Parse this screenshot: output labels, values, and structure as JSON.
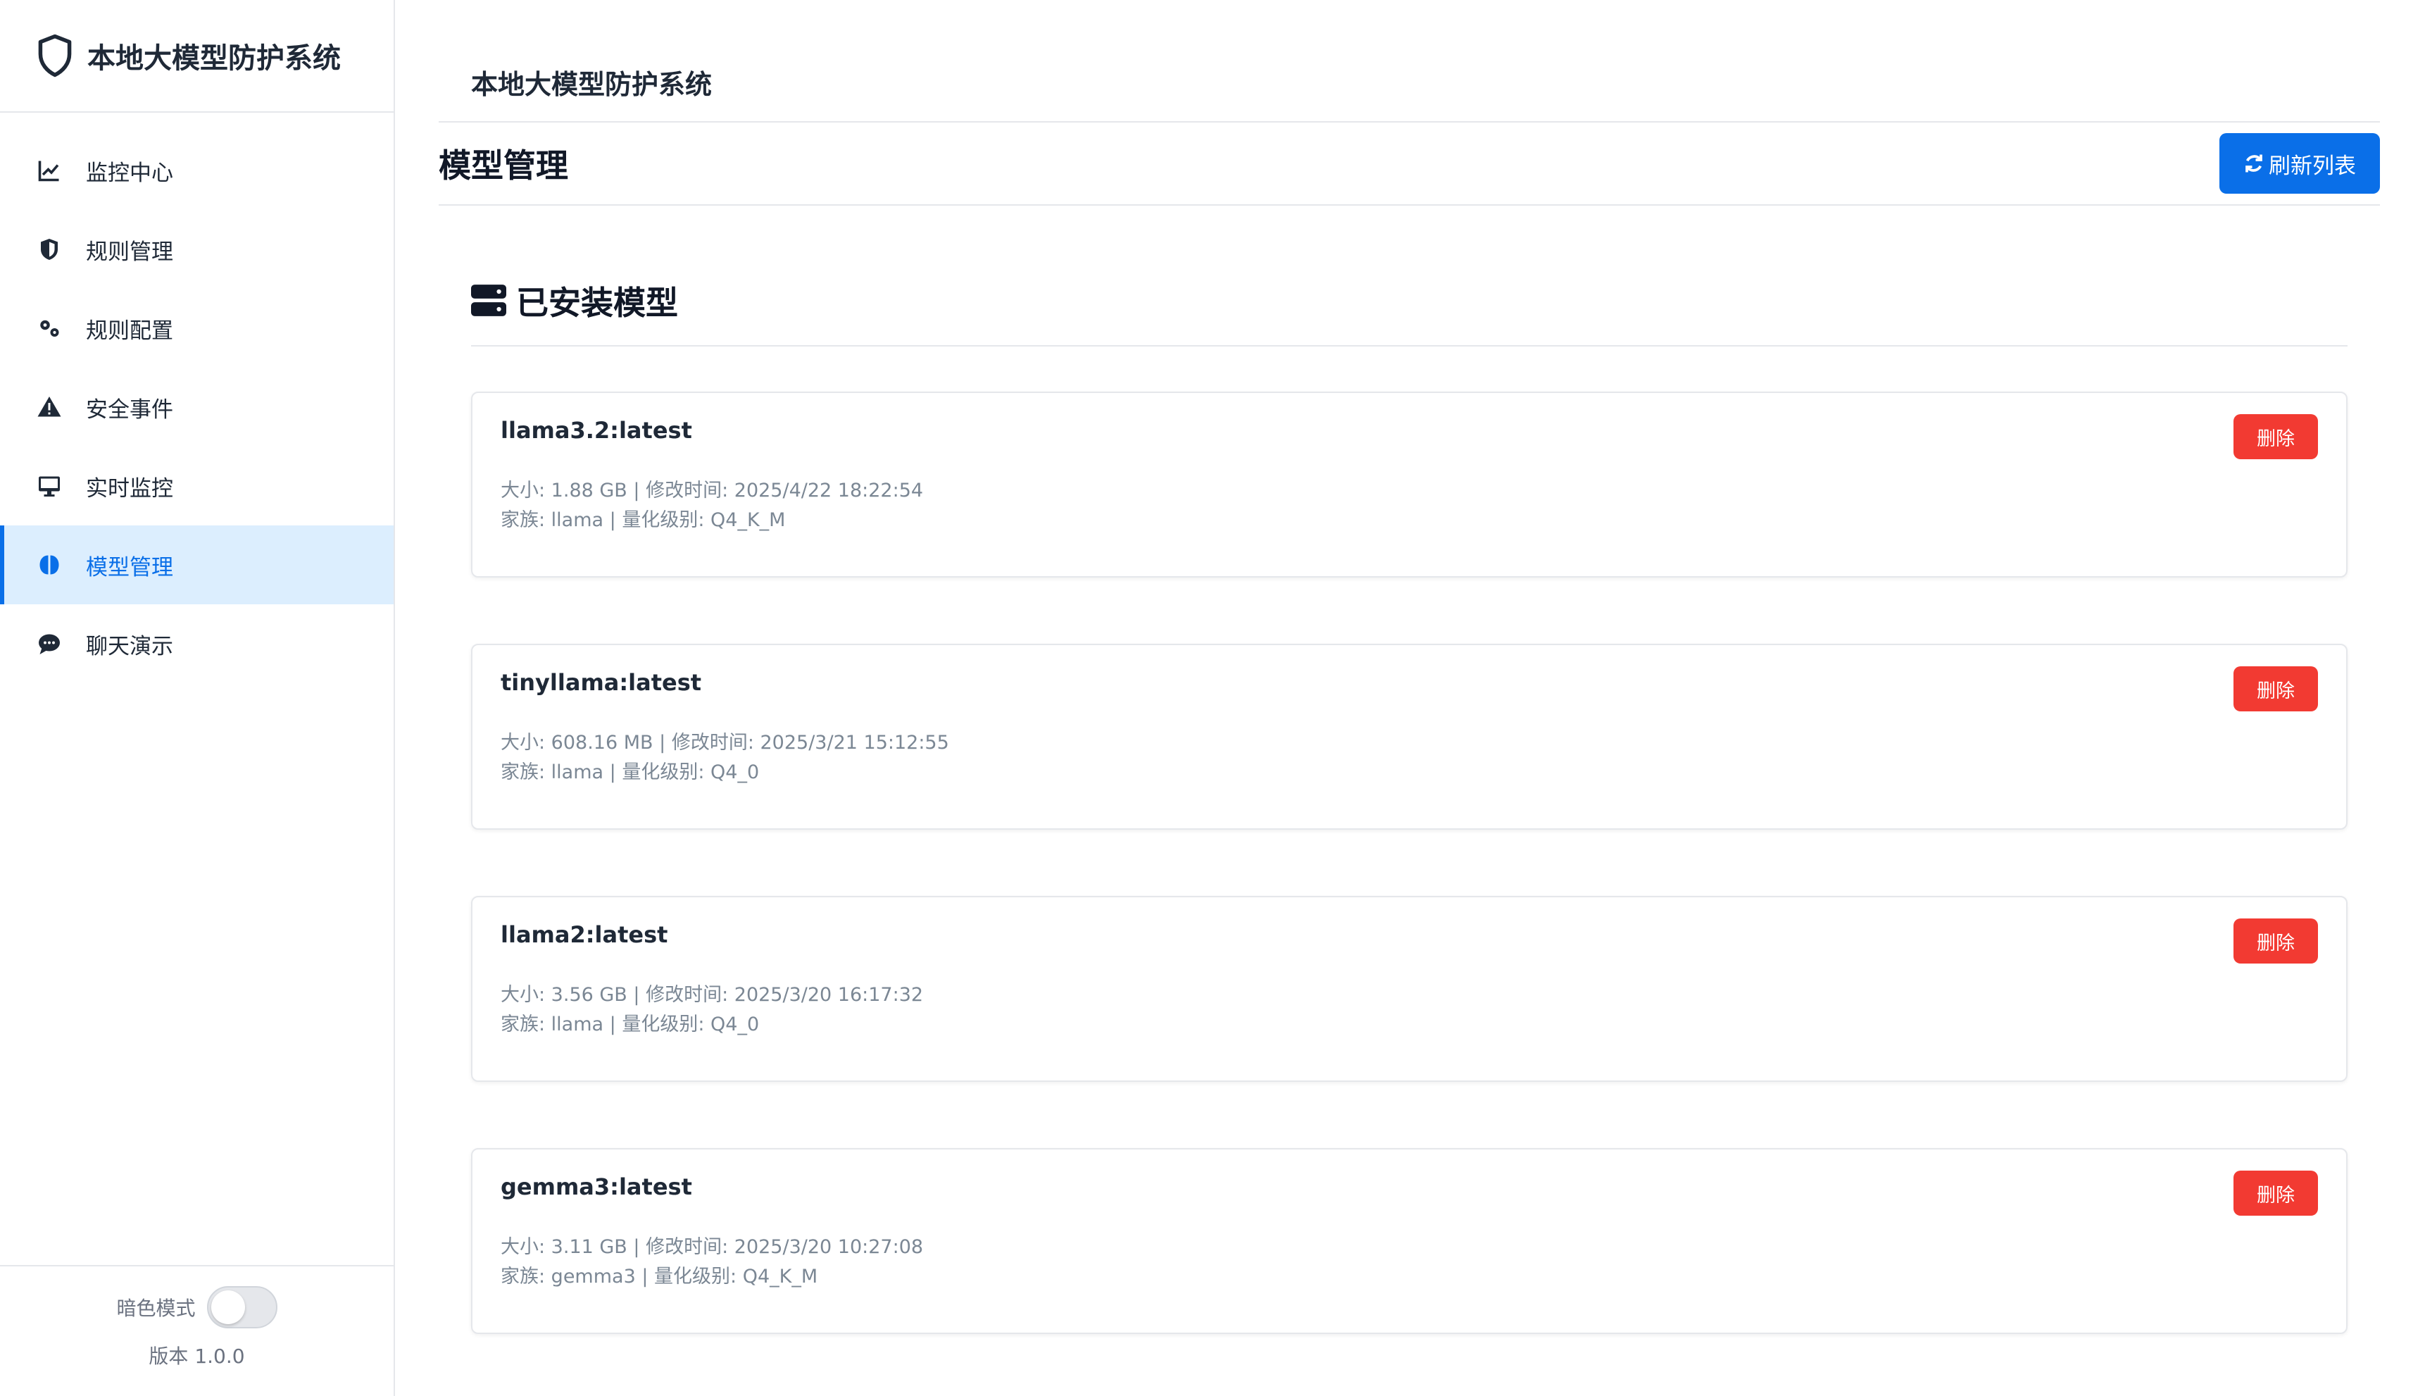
{
  "app": {
    "title": "本地大模型防护系统"
  },
  "sidebar": {
    "items": [
      {
        "label": "监控中心",
        "icon": "line-chart-icon"
      },
      {
        "label": "规则管理",
        "icon": "shield-icon"
      },
      {
        "label": "规则配置",
        "icon": "gears-icon"
      },
      {
        "label": "安全事件",
        "icon": "warning-icon"
      },
      {
        "label": "实时监控",
        "icon": "monitor-icon"
      },
      {
        "label": "模型管理",
        "icon": "brain-icon",
        "active": true
      },
      {
        "label": "聊天演示",
        "icon": "chat-icon"
      }
    ],
    "dark_mode_label": "暗色模式",
    "dark_mode_on": false,
    "version": "版本 1.0.0"
  },
  "header": {
    "title": "本地大模型防护系统"
  },
  "page": {
    "title": "模型管理",
    "refresh_label": "刷新列表"
  },
  "panel": {
    "title": "已安装模型"
  },
  "models": [
    {
      "name": "llama3.2:latest",
      "line1": "大小: 1.88 GB | 修改时间: 2025/4/22 18:22:54",
      "line2": "家族: llama | 量化级别: Q4_K_M",
      "delete_label": "删除"
    },
    {
      "name": "tinyllama:latest",
      "line1": "大小: 608.16 MB | 修改时间: 2025/3/21 15:12:55",
      "line2": "家族: llama | 量化级别: Q4_0",
      "delete_label": "删除"
    },
    {
      "name": "llama2:latest",
      "line1": "大小: 3.56 GB | 修改时间: 2025/3/20 16:17:32",
      "line2": "家族: llama | 量化级别: Q4_0",
      "delete_label": "删除"
    },
    {
      "name": "gemma3:latest",
      "line1": "大小: 3.11 GB | 修改时间: 2025/3/20 10:27:08",
      "line2": "家族: gemma3 | 量化级别: Q4_K_M",
      "delete_label": "删除"
    }
  ],
  "colors": {
    "primary": "#0a6fe8",
    "danger": "#f23a32",
    "active_bg": "#dceefe"
  }
}
